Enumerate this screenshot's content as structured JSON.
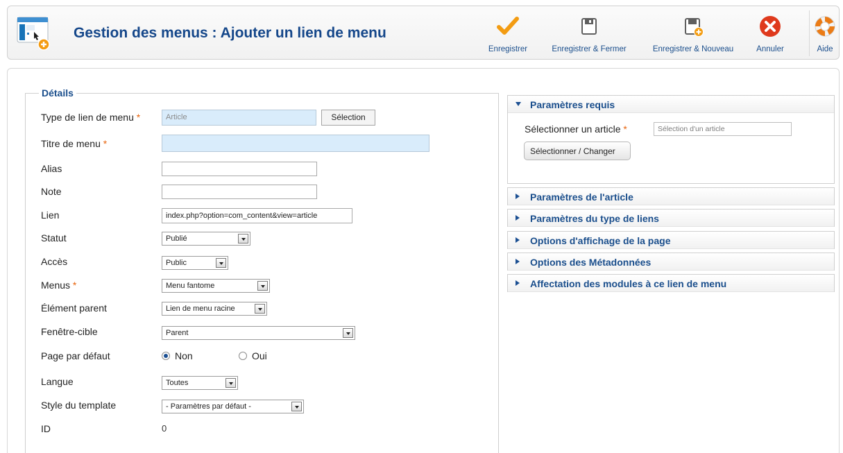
{
  "header": {
    "title": "Gestion des menus : Ajouter un lien de menu",
    "toolbar": [
      {
        "label": "Enregistrer",
        "icon": "check-icon"
      },
      {
        "label": "Enregistrer & Fermer",
        "icon": "save-icon"
      },
      {
        "label": "Enregistrer & Nouveau",
        "icon": "save-new-icon"
      },
      {
        "label": "Annuler",
        "icon": "cancel-icon"
      },
      {
        "label": "Aide",
        "icon": "lifebuoy-icon"
      }
    ]
  },
  "details": {
    "legend": "Détails",
    "required_mark": "*",
    "fields": {
      "link_type": {
        "label": "Type de lien de menu",
        "value": "Article",
        "button": "Sélection"
      },
      "menu_title": {
        "label": "Titre de menu",
        "value": ""
      },
      "alias": {
        "label": "Alias",
        "value": ""
      },
      "note": {
        "label": "Note",
        "value": ""
      },
      "link": {
        "label": "Lien",
        "value": "index.php?option=com_content&view=article"
      },
      "status": {
        "label": "Statut",
        "value": "Publié"
      },
      "access": {
        "label": "Accès",
        "value": "Public"
      },
      "menus": {
        "label": "Menus",
        "value": "Menu fantome"
      },
      "parent": {
        "label": "Élément parent",
        "value": "Lien de menu racine"
      },
      "target": {
        "label": "Fenêtre-cible",
        "value": "Parent"
      },
      "default_page": {
        "label": "Page par défaut",
        "options": [
          "Non",
          "Oui"
        ],
        "selected": "Non"
      },
      "language": {
        "label": "Langue",
        "value": "Toutes"
      },
      "template_style": {
        "label": "Style du template",
        "value": "- Paramètres par défaut -"
      },
      "id": {
        "label": "ID",
        "value": "0"
      }
    }
  },
  "panels": {
    "required": {
      "title": "Paramètres requis",
      "field_label": "Sélectionner un article",
      "field_placeholder": "Sélection d'un article",
      "button": "Sélectionner / Changer"
    },
    "collapsed": [
      "Paramètres de l'article",
      "Paramètres du type de liens",
      "Options d'affichage de la page",
      "Options des Métadonnées",
      "Affectation des modules à ce lien de menu"
    ]
  },
  "colors": {
    "title_blue": "#15478a",
    "required_orange": "#e8640c",
    "input_light_blue": "#d9ecfb"
  }
}
